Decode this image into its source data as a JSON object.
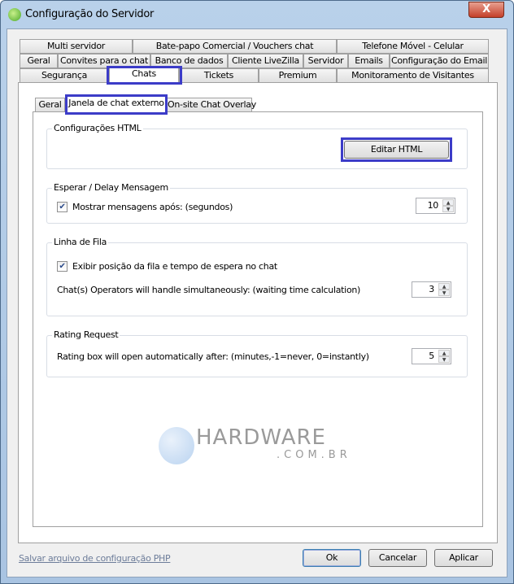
{
  "window": {
    "title": "Configuração do Servidor",
    "close": "X"
  },
  "tabs": {
    "row1": [
      "Multi servidor",
      "Bate-papo Comercial / Vouchers chat",
      "Telefone Móvel - Celular"
    ],
    "row2": [
      "Geral",
      "Convites para o chat",
      "Banco de dados",
      "Cliente LiveZilla",
      "Servidor",
      "Emails",
      "Configuração do Email"
    ],
    "row3": [
      "Segurança",
      "Chats",
      "Tickets",
      "Premium",
      "Monitoramento de Visitantes"
    ],
    "selected": "Chats"
  },
  "subtabs": {
    "items": [
      "Geral",
      "Janela de chat externo",
      "On-site Chat Overlay"
    ],
    "selected": "Janela de chat externo"
  },
  "groups": {
    "html": {
      "title": "Configurações HTML",
      "button": "Editar HTML"
    },
    "delay": {
      "title": "Esperar / Delay Mensagem",
      "checkbox": "Mostrar mensagens após: (segundos)",
      "checked": true,
      "value": "10"
    },
    "queue": {
      "title": "Linha de Fila",
      "checkbox": "Exibir posição da fila e tempo de espera no chat",
      "checked": true,
      "label": "Chat(s) Operators will handle simultaneously: (waiting time calculation)",
      "value": "3"
    },
    "rating": {
      "title": "Rating Request",
      "label": "Rating box will open automatically after: (minutes,-1=never, 0=instantly)",
      "value": "5"
    }
  },
  "watermark": {
    "line1": "HARDWARE",
    "line2": ".COM.BR"
  },
  "footer": {
    "link": "Salvar arquivo de configuração PHP",
    "ok": "Ok",
    "cancel": "Cancelar",
    "apply": "Aplicar"
  },
  "colors": {
    "highlight": "#3c3cc8"
  }
}
